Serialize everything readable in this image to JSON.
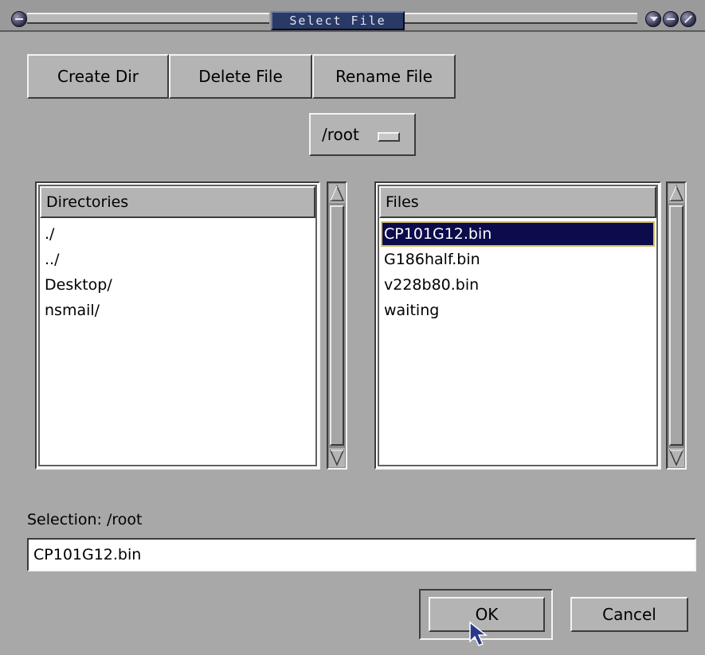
{
  "window": {
    "title": "Select File",
    "controls": [
      "menu-icon",
      "minimize-icon",
      "maximize-icon",
      "close-icon"
    ]
  },
  "toolbar": {
    "create_dir": "Create Dir",
    "delete_file": "Delete File",
    "rename_file": "Rename File"
  },
  "dir_menu": {
    "value": "/root"
  },
  "directories": {
    "header": "Directories",
    "items": [
      "./",
      "../",
      "Desktop/",
      "nsmail/"
    ]
  },
  "files": {
    "header": "Files",
    "items": [
      "CP101G12.bin",
      "G186half.bin",
      "v228b80.bin",
      "waiting"
    ],
    "selected": "CP101G12.bin"
  },
  "selection": {
    "label": "Selection: /root",
    "value": "CP101G12.bin"
  },
  "buttons": {
    "ok": "OK",
    "cancel": "Cancel"
  },
  "colors": {
    "background": "#a8a8a8",
    "title_bg": "#2a3a66",
    "selection_bg": "#0c0c4c",
    "selection_outline": "#d4c060"
  }
}
